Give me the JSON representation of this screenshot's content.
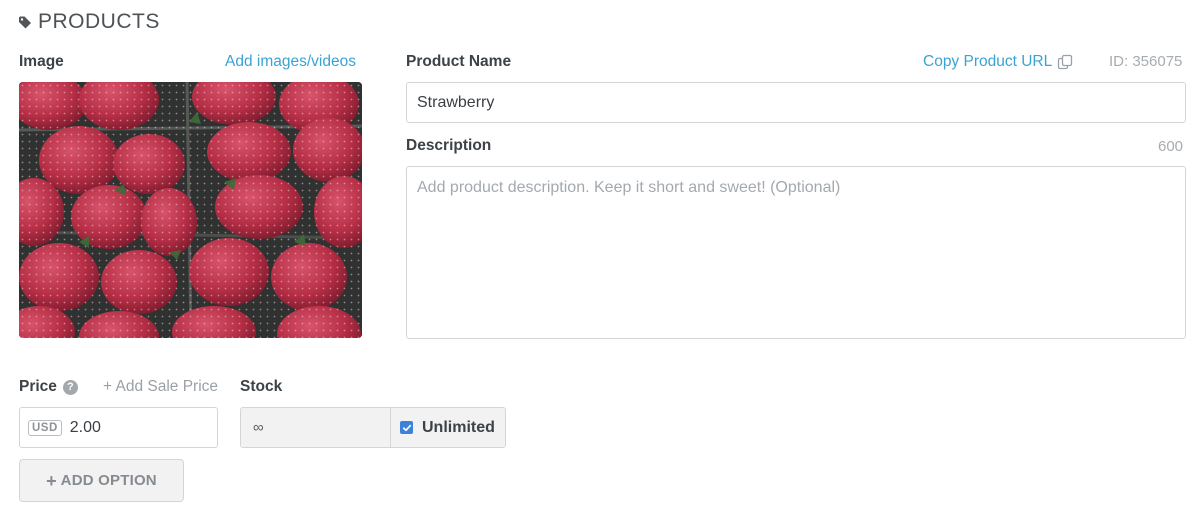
{
  "header": {
    "title": "PRODUCTS",
    "icon": "tag-icon"
  },
  "image_panel": {
    "label": "Image",
    "add_link": "Add images/videos"
  },
  "product_name": {
    "label": "Product Name",
    "copy_url": "Copy Product URL",
    "id_text": "ID: 356075",
    "value": "Strawberry"
  },
  "description": {
    "label": "Description",
    "char_count": "600",
    "placeholder": "Add product description. Keep it short and sweet! (Optional)"
  },
  "price": {
    "label": "Price",
    "help_icon": "?",
    "sale_link": "+ Add Sale Price",
    "currency": "USD",
    "value": "2.00"
  },
  "stock": {
    "label": "Stock",
    "value": "∞",
    "unlimited_label": "Unlimited",
    "unlimited_checked": true
  },
  "add_option": {
    "plus": "+",
    "label": "ADD OPTION"
  },
  "colors": {
    "link": "#3aa3d3",
    "checkbox": "#3b82d9",
    "border": "#d3d6d9"
  }
}
